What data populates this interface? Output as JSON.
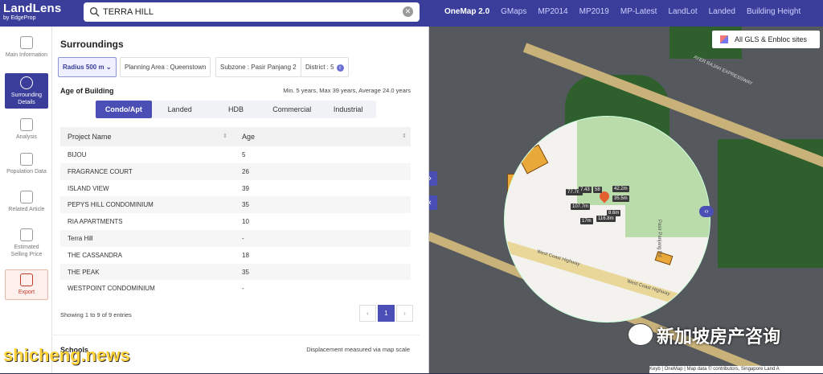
{
  "header": {
    "brand": "LandLens",
    "brand_sub": "by EdgeProp",
    "search_value": "TERRA HILL",
    "tabs": [
      {
        "label": "OneMap 2.0",
        "active": true
      },
      {
        "label": "GMaps",
        "active": false
      },
      {
        "label": "MP2014",
        "active": false
      },
      {
        "label": "MP2019",
        "active": false
      },
      {
        "label": "MP-Latest",
        "active": false
      },
      {
        "label": "LandLot",
        "active": false
      },
      {
        "label": "Landed",
        "active": false
      },
      {
        "label": "Building Height",
        "active": false
      }
    ]
  },
  "sidenav": {
    "items": [
      {
        "label": "Main Information",
        "icon": "info-card-icon"
      },
      {
        "label": "Surrounding Details",
        "icon": "surroundings-icon",
        "active": true
      },
      {
        "label": "Analysis",
        "icon": "analysis-icon"
      },
      {
        "label": "Population Data",
        "icon": "population-icon"
      },
      {
        "label": "Related Article",
        "icon": "article-icon"
      },
      {
        "label": "Estimated Selling Price",
        "icon": "price-icon"
      },
      {
        "label": "Export",
        "icon": "export-icon"
      }
    ]
  },
  "surroundings": {
    "title": "Surroundings",
    "radius": "Radius 500 m",
    "planning_area": "Planning Area : Queenstown",
    "subzone": "Subzone : Pasir Panjang 2",
    "district": "District : 5",
    "age_title": "Age of Building",
    "age_summary": "Min. 5 years, Max 39 years, Average 24.0 years",
    "segments": [
      "Condo/Apt",
      "Landed",
      "HDB",
      "Commercial",
      "Industrial"
    ],
    "active_segment": 0,
    "table": {
      "headers": [
        "Project Name",
        "Age"
      ],
      "rows": [
        [
          "BIJOU",
          "5"
        ],
        [
          "FRAGRANCE COURT",
          "26"
        ],
        [
          "ISLAND VIEW",
          "39"
        ],
        [
          "PEPYS HILL CONDOMINIUM",
          "35"
        ],
        [
          "RIA APARTMENTS",
          "10"
        ],
        [
          "Terra Hill",
          "-"
        ],
        [
          "THE CASSANDRA",
          "18"
        ],
        [
          "THE PEAK",
          "35"
        ],
        [
          "WESTPOINT CONDOMINIUM",
          "-"
        ]
      ]
    },
    "showing": "Showing 1 to 9 of 9 entries",
    "page_prev": "‹",
    "page_current": "1",
    "page_next": "›",
    "schools_title": "Schools",
    "schools_note": "Displacement measured via map scale"
  },
  "map": {
    "gls_label": "All GLS & Enbloc sites",
    "distances": [
      "77.7m",
      "7.43",
      "58",
      "42.2m",
      "35.5m",
      "107.7m",
      "8.6m",
      "17m",
      "116.8m"
    ],
    "road_labels": [
      "AYER RAJAH EXPRESSWAY",
      "West Coast Highway",
      "West Coast Highway",
      "Pasir Panjang Rd"
    ],
    "footer": "Keyb | OneMap | Map data © contributors, Singapore Land A",
    "btn_expand": "›",
    "btn_collapse": "‹",
    "handle": "‹›"
  },
  "watermarks": {
    "wechat": "新加坡房产咨询",
    "site": "shicheng.news"
  }
}
